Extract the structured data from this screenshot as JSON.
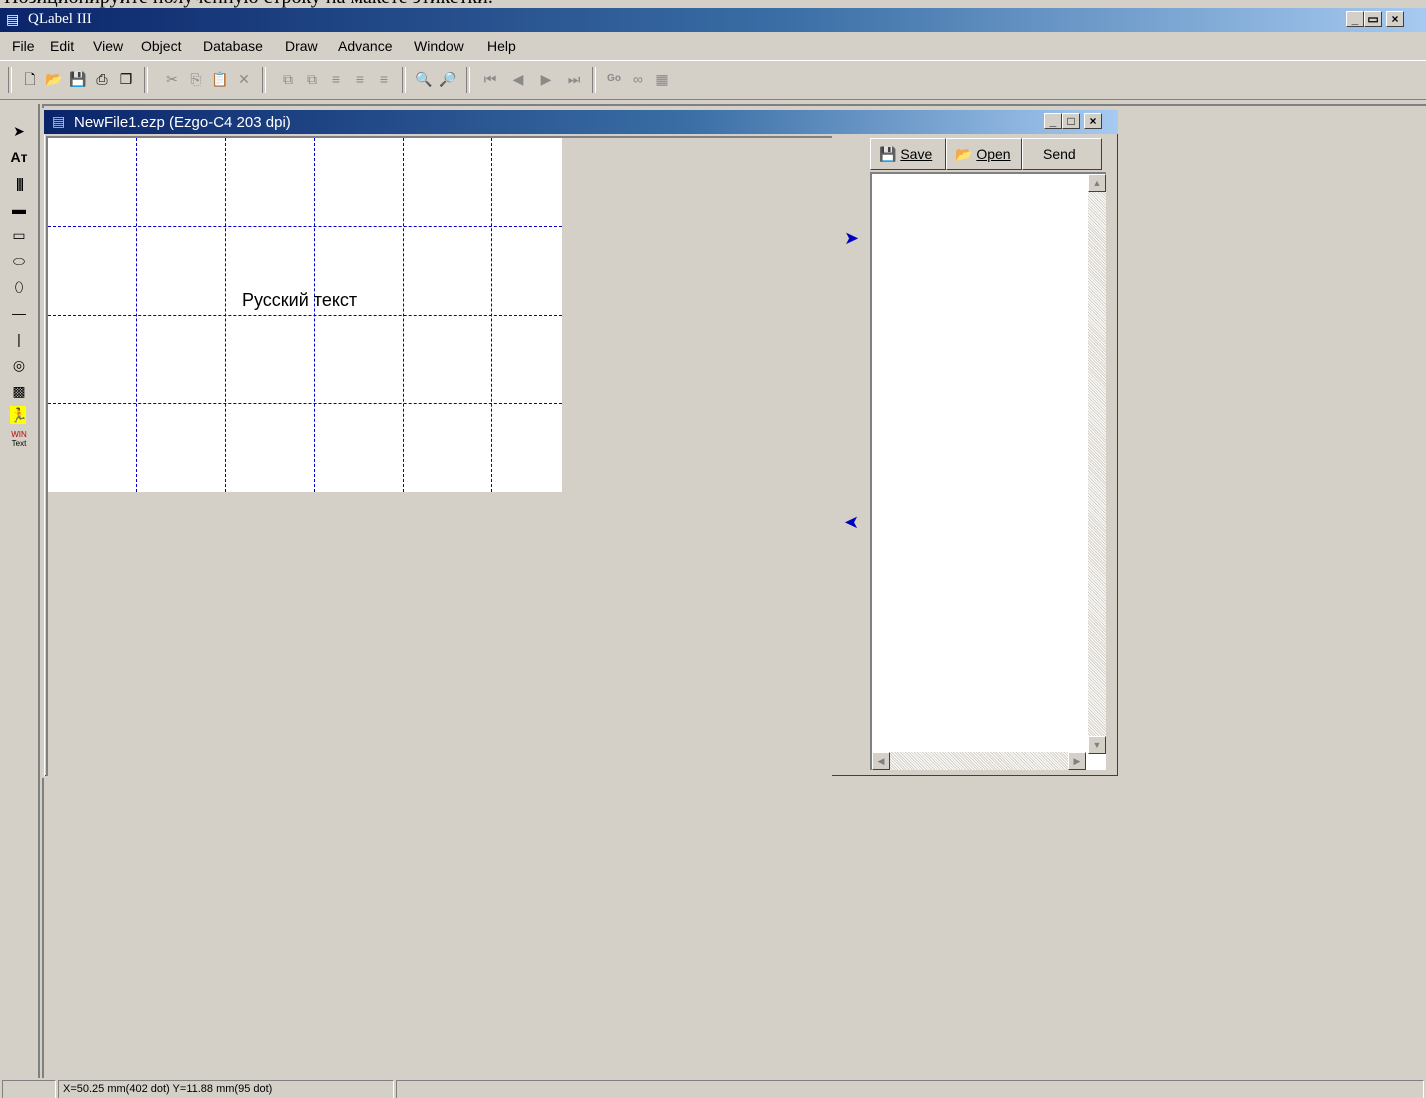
{
  "top_caption": "Позиционируйте полученную строку на макете этикетки.",
  "app": {
    "title": "QLabel III"
  },
  "window_controls": {
    "minimize": "_",
    "restore": "▭",
    "close": "×"
  },
  "menu": [
    {
      "label": "File"
    },
    {
      "label": "Edit"
    },
    {
      "label": "View"
    },
    {
      "label": "Object"
    },
    {
      "label": "Database"
    },
    {
      "label": "Draw"
    },
    {
      "label": "Advance"
    },
    {
      "label": "Window"
    },
    {
      "label": "Help"
    }
  ],
  "toolbar": {
    "go_label": "Go"
  },
  "child_window": {
    "title": "NewFile1.ezp   (Ezgo-C4    203 dpi)",
    "minimize": "_",
    "maximize": "□",
    "close": "×"
  },
  "label_canvas": {
    "text": "Русский текст"
  },
  "panel": {
    "save_label": "Save",
    "open_label": "Open",
    "send_label": "Send"
  },
  "status": {
    "coords": "X=50.25 mm(402 dot)  Y=11.88 mm(95 dot)"
  },
  "icons": {
    "new": "new-file-icon",
    "open": "open-folder-icon",
    "save": "floppy-icon",
    "print": "printer-icon",
    "copy_doc": "copy-doc-icon",
    "cut": "cut-icon",
    "copy": "copy-icon",
    "paste": "paste-icon",
    "delete": "delete-icon",
    "zoom_out": "zoom-out-icon",
    "zoom_in": "zoom-in-icon",
    "first": "first-record-icon",
    "prev": "prev-record-icon",
    "next": "next-record-icon",
    "last": "last-record-icon"
  },
  "colors": {
    "title_start": "#0a246a",
    "title_end": "#a6caf0",
    "grid": "#0000c8",
    "face": "#d4d0c8"
  }
}
